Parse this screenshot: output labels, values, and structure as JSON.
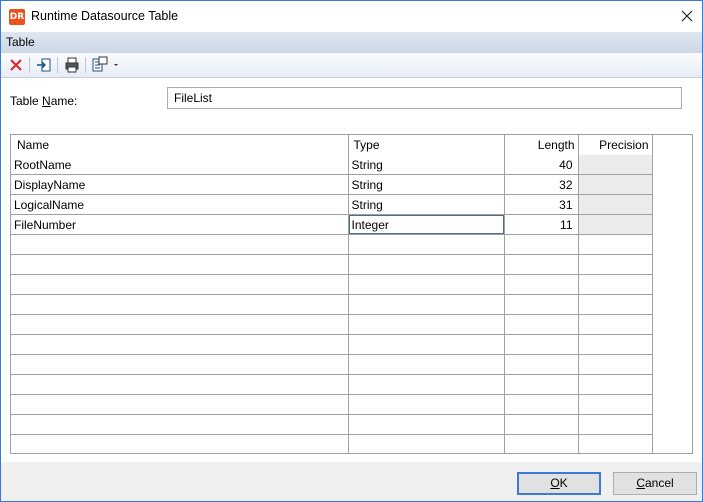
{
  "window": {
    "title": "Runtime Datasource Table",
    "logo_text": "DR"
  },
  "menu": {
    "items": [
      "Table"
    ]
  },
  "toolbar": {
    "icons": [
      "delete-icon",
      "insert-row-icon",
      "printer-icon",
      "field-list-dropdown-icon"
    ]
  },
  "form": {
    "table_name_label_prefix": "Table ",
    "table_name_label_accel": "N",
    "table_name_label_suffix": "ame:",
    "table_name_value": "FileList"
  },
  "grid": {
    "columns": [
      "Name",
      "Type",
      "Length",
      "Precision"
    ],
    "rows": [
      {
        "name": "RootName",
        "type": "String",
        "length": "40",
        "precision": ""
      },
      {
        "name": "DisplayName",
        "type": "String",
        "length": "32",
        "precision": ""
      },
      {
        "name": "LogicalName",
        "type": "String",
        "length": "31",
        "precision": ""
      },
      {
        "name": "FileNumber",
        "type": "Integer",
        "length": "11",
        "precision": ""
      }
    ],
    "empty_rows": 11
  },
  "buttons": {
    "ok_accel": "O",
    "ok_rest": "K",
    "cancel_accel": "C",
    "cancel_rest": "ancel"
  },
  "colors": {
    "accent": "#3d7ad4",
    "logo": "#e9521d",
    "delete": "#e0202a"
  }
}
